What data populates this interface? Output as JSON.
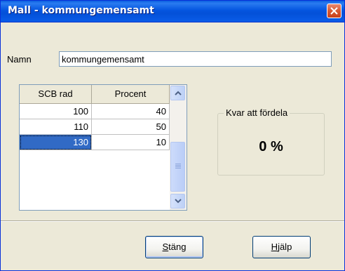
{
  "window": {
    "title": "Mall - kommungemensamt",
    "close_icon": "close-icon"
  },
  "form": {
    "name_label": "Namn",
    "name_value": "kommungemensamt"
  },
  "grid": {
    "columns": [
      "SCB rad",
      "Procent"
    ],
    "rows": [
      {
        "scb_rad": "100",
        "procent": "40"
      },
      {
        "scb_rad": "110",
        "procent": "50"
      },
      {
        "scb_rad": "130",
        "procent": "10"
      }
    ],
    "selected_row": 2
  },
  "remaining": {
    "title": "Kvar att fördela",
    "value": "0 %"
  },
  "buttons": {
    "close_mnemonic": "S",
    "close_rest": "täng",
    "help_mnemonic": "H",
    "help_rest": "jälp"
  },
  "colors": {
    "titlebar": "#0556e0",
    "dialog_bg": "#ece9d8",
    "selection": "#316ac5"
  }
}
